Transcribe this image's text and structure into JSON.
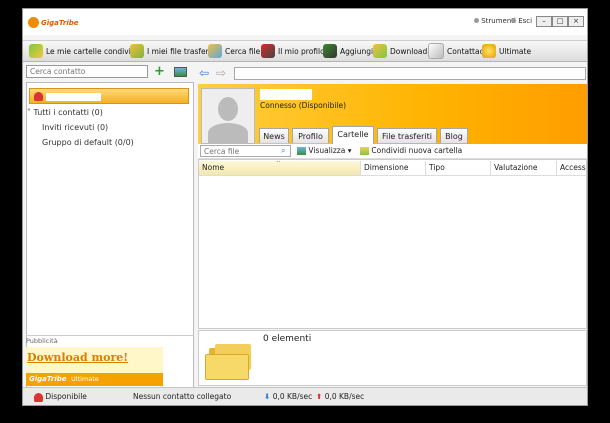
{
  "titlebar": {
    "logo": "GigaTribe",
    "tools_label": "Strumenti",
    "exit_label": "Esci"
  },
  "toolbar": {
    "items": [
      {
        "label": "Le mie cartelle condivise",
        "icon": "shared-folders-icon"
      },
      {
        "label": "I miei file trasferiti",
        "icon": "transfers-icon"
      },
      {
        "label": "Cerca file",
        "icon": "search-files-icon"
      },
      {
        "label": "Il mio profilo",
        "icon": "profile-icon"
      },
      {
        "label": "Aggiungi",
        "icon": "add-contact-icon"
      },
      {
        "label": "Download",
        "icon": "download-icon"
      },
      {
        "label": "Contattaci",
        "icon": "contact-icon"
      },
      {
        "label": "Ultimate",
        "icon": "ultimate-icon"
      }
    ]
  },
  "left": {
    "search_placeholder": "Cerca contatto",
    "tree": {
      "all_contacts": "Tutti i contatti (0)",
      "invites": "Inviti ricevuti (0)",
      "default_group": "Gruppo di default (0/0)"
    },
    "ad": {
      "section_label": "Pubblicità",
      "link": "Download more!",
      "brand": "GigaTribe",
      "brand_sub": "Ultimate"
    }
  },
  "profile": {
    "status": "Connesso (Disponibile)",
    "tabs": [
      "News",
      "Profilo",
      "Cartelle",
      "File trasferiti",
      "Blog"
    ],
    "active_tab": "Cartelle"
  },
  "files": {
    "search_placeholder": "Cerca file",
    "view_label": "Visualizza",
    "share_label": "Condividi nuova cartella",
    "columns": [
      "Nome",
      "Dimensione",
      "Tipo",
      "Valutazione",
      "Accesso"
    ],
    "count_label": "0 elementi"
  },
  "statusbar": {
    "availability": "Disponibile",
    "connection": "Nessun contatto collegato",
    "download_speed": "0,0 KB/sec",
    "upload_speed": "0,0 KB/sec"
  },
  "colors": {
    "accent": "#f5a200",
    "selection": "#ffd978"
  }
}
